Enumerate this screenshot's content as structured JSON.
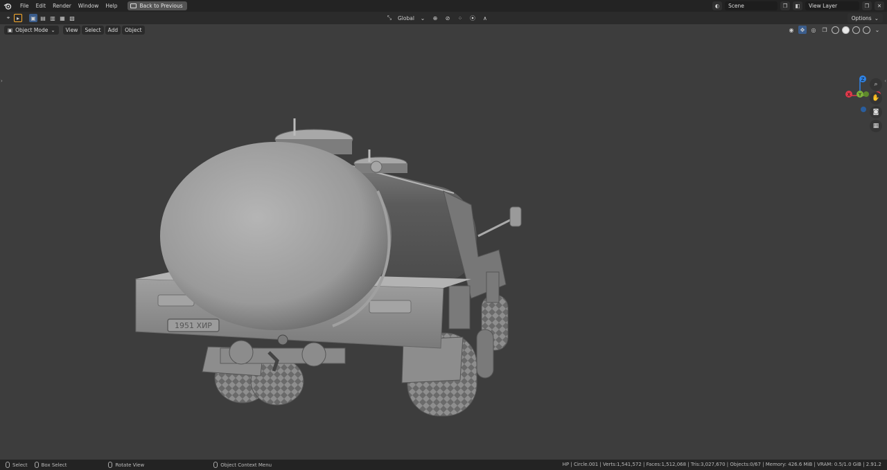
{
  "topbar": {
    "menus": [
      "File",
      "Edit",
      "Render",
      "Window",
      "Help"
    ],
    "back_label": "Back to Previous",
    "scene_value": "Scene",
    "view_layer_value": "View Layer"
  },
  "toolbar": {
    "transform_orientation": "Global",
    "options_label": "Options"
  },
  "header": {
    "mode_label": "Object Mode",
    "menus": [
      "View",
      "Select",
      "Add",
      "Object"
    ]
  },
  "gizmo": {
    "x_label": "X",
    "y_label": "Y",
    "z_label": "Z",
    "x_color": "#e2394b",
    "y_color": "#7fb33a",
    "z_color": "#2f83e6"
  },
  "model": {
    "plate_text": "1951 ХИР"
  },
  "statusbar": {
    "select_label": "Select",
    "box_select_label": "Box Select",
    "rotate_label": "Rotate View",
    "context_label": "Object Context Menu",
    "stats": "HP | Circle.001 | Verts:1,541,572 | Faces:1,512,068 | Tris:3,027,670 | Objects:0/67 | Memory: 426.6 MiB | VRAM: 0.5/1.0 GiB | 2.91.2"
  }
}
